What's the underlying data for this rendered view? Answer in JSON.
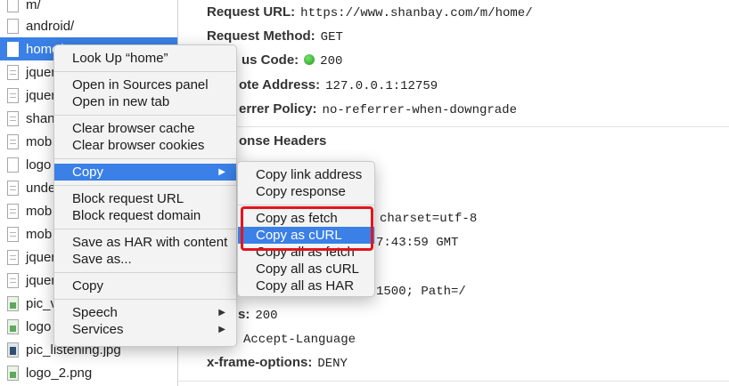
{
  "file_list": [
    {
      "name": "m/",
      "icon": "document-icon",
      "kind": "plain"
    },
    {
      "name": "android/",
      "icon": "document-icon",
      "kind": "plain"
    },
    {
      "name": "home/",
      "icon": "document-icon",
      "kind": "plain",
      "selected": true
    },
    {
      "name": "jquer",
      "icon": "script-icon",
      "kind": "script"
    },
    {
      "name": "jquer",
      "icon": "script-icon",
      "kind": "script"
    },
    {
      "name": "shan",
      "icon": "script-icon",
      "kind": "script"
    },
    {
      "name": "mob",
      "icon": "script-icon",
      "kind": "script"
    },
    {
      "name": "logo",
      "icon": "document-icon",
      "kind": "plain"
    },
    {
      "name": "unde",
      "icon": "script-icon",
      "kind": "script"
    },
    {
      "name": "mob",
      "icon": "script-icon",
      "kind": "script"
    },
    {
      "name": "mob",
      "icon": "script-icon",
      "kind": "script"
    },
    {
      "name": "jquer",
      "icon": "script-icon",
      "kind": "script"
    },
    {
      "name": "jquer",
      "icon": "script-icon",
      "kind": "script"
    },
    {
      "name": "pic_v",
      "icon": "image-icon",
      "kind": "image"
    },
    {
      "name": "logo",
      "icon": "image-icon",
      "kind": "image"
    },
    {
      "name": "pic_listening.jpg",
      "icon": "image-icon",
      "kind": "image-dark"
    },
    {
      "name": "logo_2.png",
      "icon": "image-icon",
      "kind": "image"
    }
  ],
  "details": {
    "request_url": {
      "key": "Request URL:",
      "value": "https://www.shanbay.com/m/home/"
    },
    "request_method": {
      "key": "Request Method:",
      "value": "GET"
    },
    "status_code": {
      "key": "us Code:",
      "value": "200"
    },
    "remote_address": {
      "key": "ote Address:",
      "value": "127.0.0.1:12759"
    },
    "referrer_policy": {
      "key": "errer Policy:",
      "value": "no-referrer-when-downgrade"
    },
    "response_headers_title": "onse Headers",
    "content_type_frag": "charset=utf-8",
    "date_frag": "7:43:59 GMT",
    "cookie_frag": "1500; Path=/",
    "status_frag": {
      "key": "s:",
      "value": "200"
    },
    "vary_frag": "Accept-Language",
    "x_frame_options": {
      "key": "x-frame-options:",
      "value": "DENY"
    }
  },
  "context_menu": {
    "look_up": "Look Up “home”",
    "open_sources": "Open in Sources panel",
    "open_new_tab": "Open in new tab",
    "clear_cache": "Clear browser cache",
    "clear_cookies": "Clear browser cookies",
    "copy_submenu": "Copy",
    "block_url": "Block request URL",
    "block_domain": "Block request domain",
    "save_har": "Save as HAR with content",
    "save_as": "Save as...",
    "copy": "Copy",
    "speech": "Speech",
    "services": "Services",
    "submenu_arrow": "▶"
  },
  "copy_submenu": {
    "items": [
      "Copy link address",
      "Copy response",
      "Copy as fetch",
      "Copy as cURL",
      "Copy all as fetch",
      "Copy all as cURL",
      "Copy all as HAR"
    ],
    "active": "Copy as cURL"
  },
  "colors": {
    "selection": "#3a80e6",
    "highlight_border": "#e2151d",
    "status_ok": "#1f9a1f"
  }
}
